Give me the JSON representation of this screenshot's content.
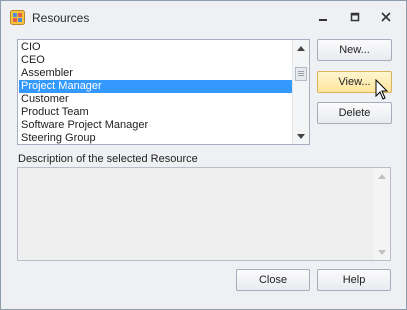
{
  "window": {
    "title": "Resources"
  },
  "icons": {
    "app": "app-icon",
    "minimize": "minimize-icon",
    "restore": "restore-icon",
    "close": "close-icon"
  },
  "resources_list": {
    "items": [
      "CIO",
      "CEO",
      "Assembler",
      "Project Manager",
      "Customer",
      "Product Team",
      "Software Project Manager",
      "Steering Group"
    ],
    "selected_index": 3
  },
  "buttons": {
    "new": "New...",
    "view": "View...",
    "delete": "Delete",
    "close": "Close",
    "help": "Help"
  },
  "description": {
    "label": "Description of the selected Resource",
    "value": ""
  },
  "colors": {
    "selection": "#3399ff",
    "hover_button": "#ffe59b"
  }
}
